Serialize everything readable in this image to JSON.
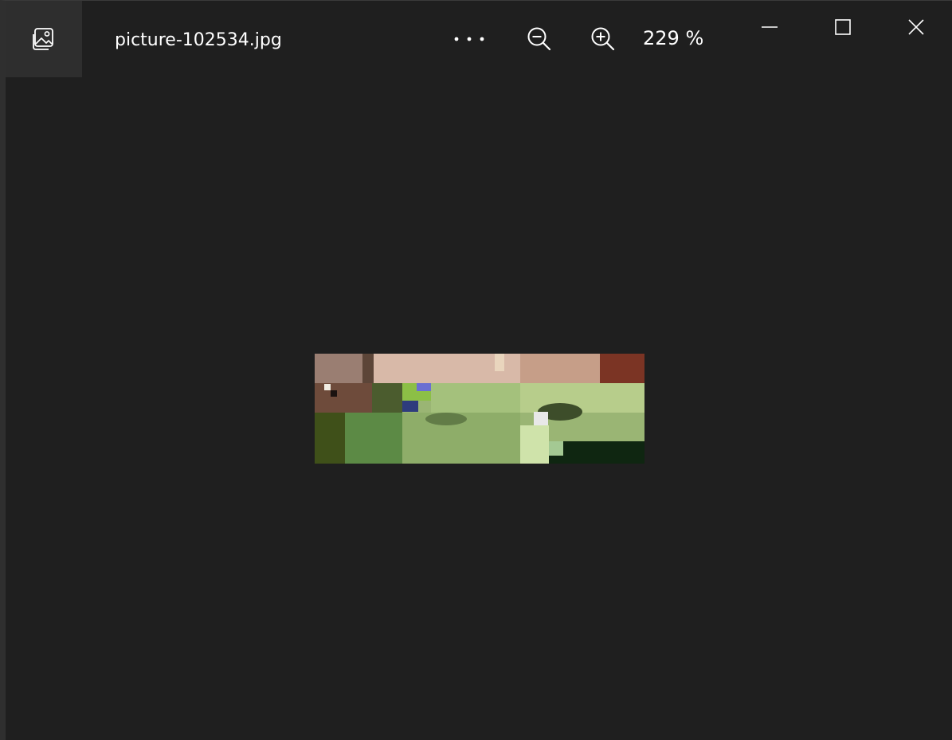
{
  "window": {
    "file_name": "picture-102534.jpg",
    "zoom_level": "229 %"
  },
  "toolbar": {
    "app_icon": "image-icon",
    "more_icon": "more-dots-icon",
    "zoom_out_icon": "zoom-out-icon",
    "zoom_in_icon": "zoom-in-icon"
  },
  "window_controls": {
    "minimize_icon": "minimize-icon",
    "maximize_icon": "maximize-icon",
    "close_icon": "close-icon"
  },
  "colors": {
    "background": "#1f1f1f",
    "titlebar_button": "#2e2e2e",
    "text": "#ffffff"
  }
}
